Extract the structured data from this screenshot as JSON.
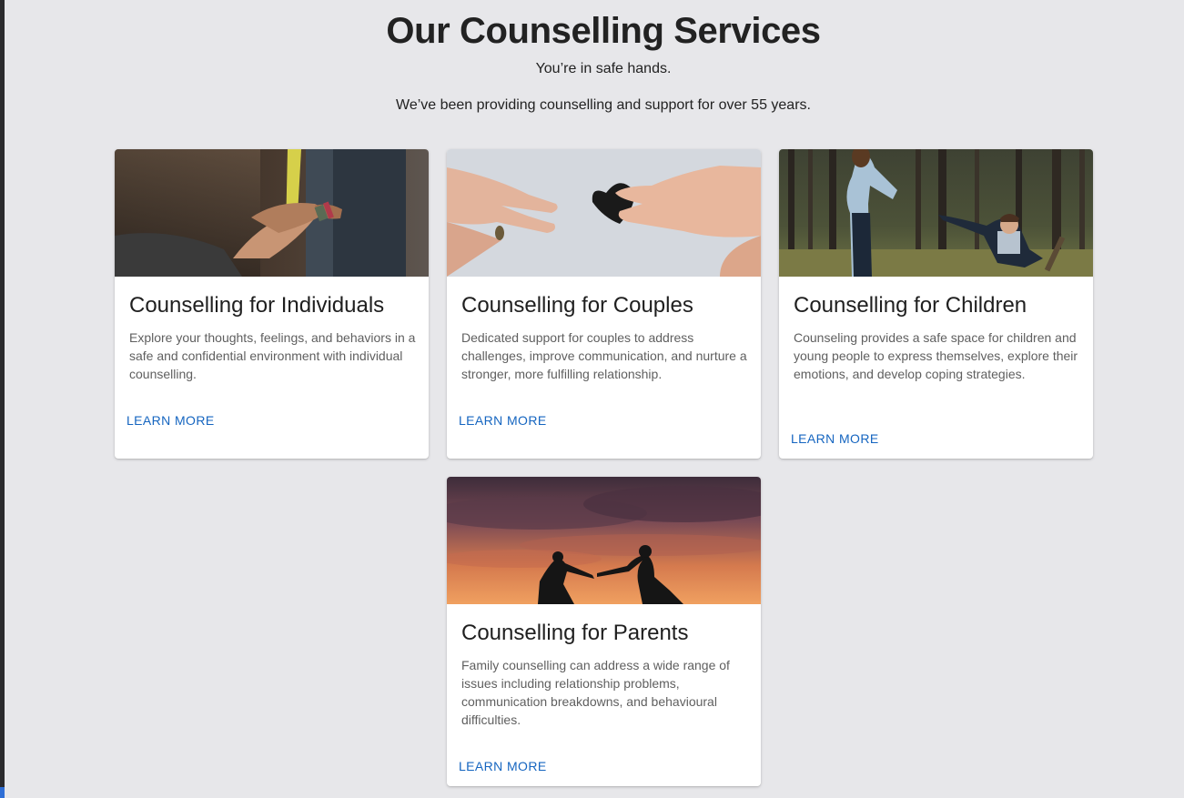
{
  "header": {
    "title": "Our Counselling Services",
    "subtitle": "You’re in safe hands.",
    "tagline": "We’ve been providing counselling and support for over 55 years."
  },
  "cards": [
    {
      "title": "Counselling for Individuals",
      "description": "Explore your thoughts, feelings, and behaviors in a safe and confidential environment with individual counselling.",
      "button": "LEARN MORE",
      "image": "hands-touching-photo"
    },
    {
      "title": "Counselling for Couples",
      "description": "Dedicated support for couples to address challenges, improve communication, and nurture a stronger, more fulfilling relationship.",
      "button": "LEARN MORE",
      "image": "hands-paper-heart-photo"
    },
    {
      "title": "Counselling for Children",
      "description": "Counseling provides a safe space for children and young people to express themselves, explore their emotions, and develop coping strategies.",
      "button": "LEARN MORE",
      "image": "parent-child-forest-photo"
    },
    {
      "title": "Counselling for Parents",
      "description": "Family counselling can address a wide range of issues including relationship problems, communication breakdowns, and behavioural difficulties.",
      "button": "LEARN MORE",
      "image": "sunset-silhouette-photo"
    }
  ],
  "colors": {
    "background": "#e7e7ea",
    "card": "#ffffff",
    "link": "#1565c0"
  }
}
